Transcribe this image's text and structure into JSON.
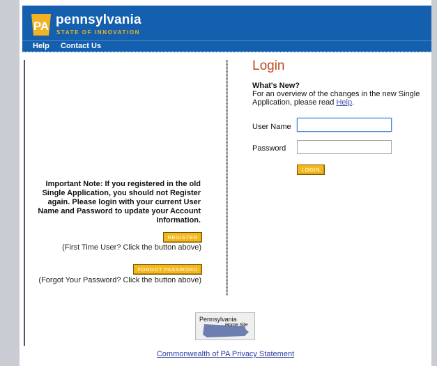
{
  "brand": {
    "badge": "PA",
    "name": "pennsylvania",
    "tagline": "STATE OF INNOVATION"
  },
  "nav": {
    "help": "Help",
    "contact": "Contact Us"
  },
  "left": {
    "important_note": "Important Note: If you registered in the old Single Application, you should not Register again. Please login with your current User Name and Password to update your Account Information.",
    "register_label": "REGISTER",
    "register_hint": "(First Time User? Click the button above)",
    "forgot_label": "FORGOT PASSWORD",
    "forgot_hint": "(Forgot Your Password? Click the button above)"
  },
  "login": {
    "title": "Login",
    "whats_new_heading": "What's New?",
    "whats_new_text": "For an overview of the changes in the new Single Application, please read ",
    "help_link": "Help",
    "whats_new_end": ".",
    "username_label": "User Name",
    "username_value": "",
    "password_label": "Password",
    "password_value": "",
    "login_label": "LOGIN"
  },
  "footer": {
    "home_site_title": "Pennsylvania",
    "home_site_sub": "Home Site",
    "privacy_link": "Commonwealth of PA Privacy Statement"
  },
  "colors": {
    "header_blue": "#1460ae",
    "button_yellow": "#f4b81c",
    "login_title": "#b94a1c"
  }
}
